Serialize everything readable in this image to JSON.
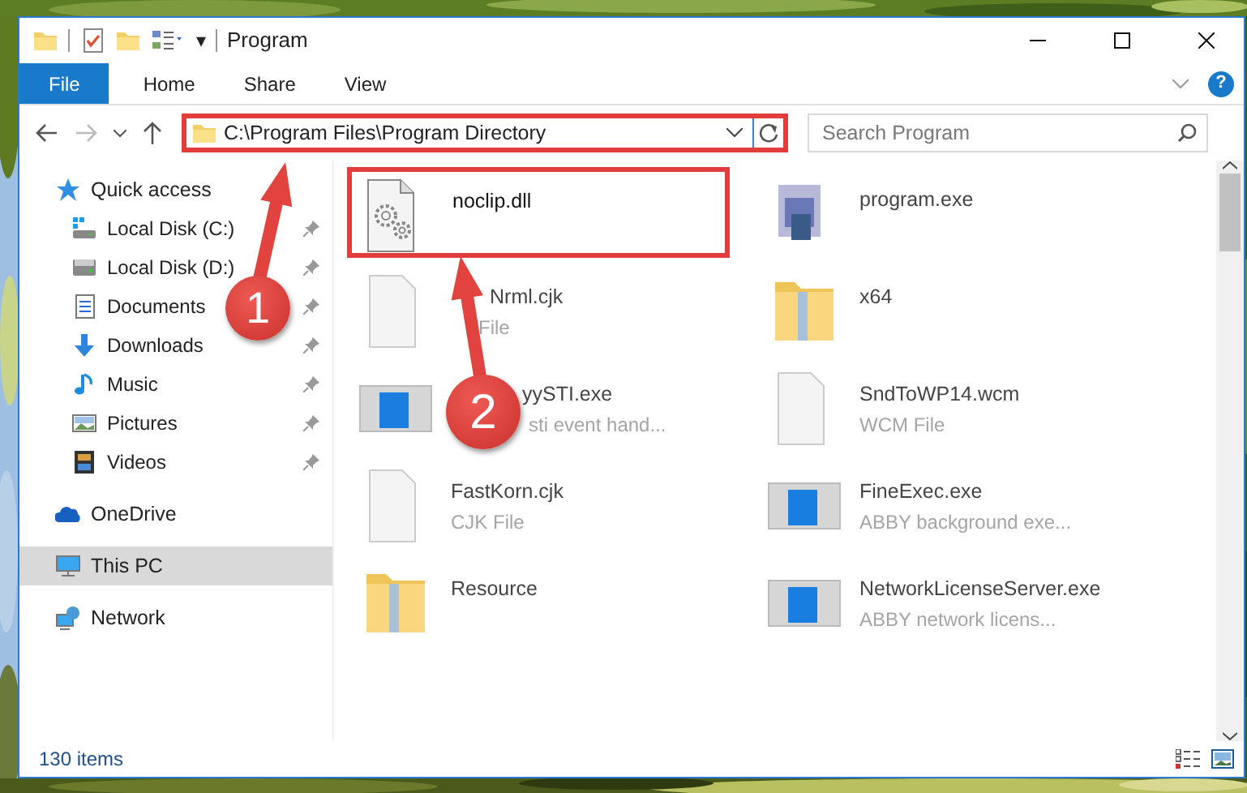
{
  "window": {
    "title": "Program"
  },
  "quick_toolbar": {
    "menu_glyph": "▾"
  },
  "ribbon": {
    "tabs": [
      {
        "label": "File",
        "kind": "file",
        "selected": false
      },
      {
        "label": "Home",
        "kind": "tab",
        "selected": false
      },
      {
        "label": "Share",
        "kind": "tab",
        "selected": false
      },
      {
        "label": "View",
        "kind": "tab",
        "selected": false
      }
    ],
    "help_glyph": "?"
  },
  "address_bar": {
    "path": "C:\\Program Files\\Program Directory",
    "highlighted": true
  },
  "search": {
    "placeholder": "Search Program"
  },
  "navigation": [
    {
      "label": "Quick access",
      "kind": "star",
      "selected": false,
      "children": [
        {
          "label": "Local Disk (C:)",
          "kind": "system-drive",
          "pinned": true,
          "selected": false
        },
        {
          "label": "Local Disk (D:)",
          "kind": "drive",
          "pinned": true,
          "selected": false
        },
        {
          "label": "Documents",
          "kind": "documents",
          "pinned": true,
          "selected": false
        },
        {
          "label": "Downloads",
          "kind": "downloads",
          "pinned": true,
          "selected": false
        },
        {
          "label": "Music",
          "kind": "music",
          "pinned": true,
          "selected": false
        },
        {
          "label": "Pictures",
          "kind": "pictures",
          "pinned": true,
          "selected": false
        },
        {
          "label": "Videos",
          "kind": "videos",
          "pinned": true,
          "selected": false
        }
      ]
    },
    {
      "label": "OneDrive",
      "kind": "cloud",
      "selected": false
    },
    {
      "label": "This PC",
      "kind": "computer",
      "selected": true
    },
    {
      "label": "Network",
      "kind": "network",
      "selected": false
    }
  ],
  "files": [
    {
      "name": "noclip.dll",
      "kind": "library",
      "highlighted": true
    },
    {
      "name": "program.exe",
      "kind": "installer",
      "highlighted": false
    },
    {
      "name": "Nrml.cjk",
      "detail": "File",
      "kind": "file",
      "highlighted": false
    },
    {
      "name": "x64",
      "kind": "folder",
      "highlighted": false
    },
    {
      "name": "yySTI.exe",
      "detail": "sti event hand...",
      "kind": "application",
      "highlighted": false
    },
    {
      "name": "SndToWP14.wcm",
      "detail": "WCM File",
      "kind": "file",
      "highlighted": false
    },
    {
      "name": "FastKorn.cjk",
      "detail": "CJK File",
      "kind": "file",
      "highlighted": false
    },
    {
      "name": "FineExec.exe",
      "detail": "ABBY background exe...",
      "kind": "application",
      "highlighted": false
    },
    {
      "name": "Resource",
      "kind": "folder",
      "highlighted": false
    },
    {
      "name": "NetworkLicenseServer.exe",
      "detail": "ABBY network licens...",
      "kind": "application",
      "highlighted": false
    }
  ],
  "status_bar": {
    "item_count": "130 items"
  },
  "callouts": [
    {
      "number": "1"
    },
    {
      "number": "2"
    }
  ]
}
